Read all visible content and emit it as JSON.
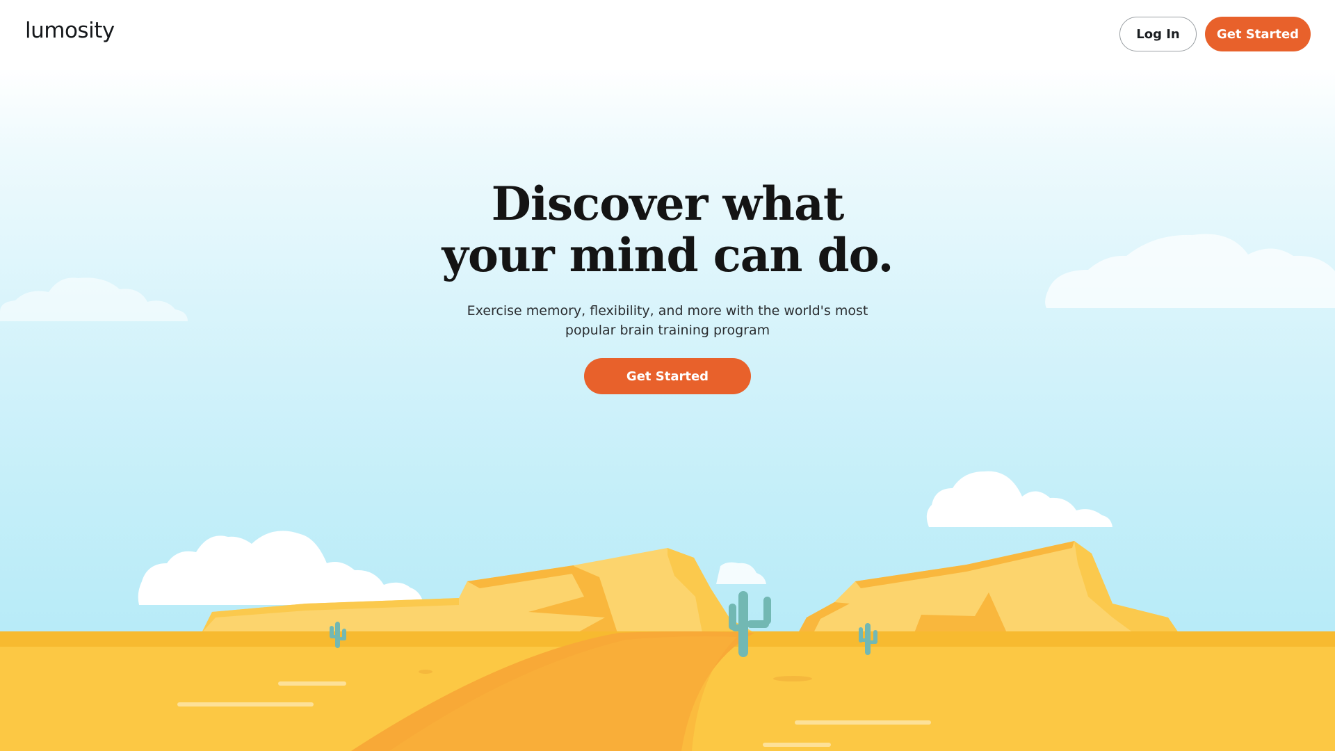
{
  "header": {
    "logo_text": "lumosity",
    "login_label": "Log In",
    "get_started_label": "Get Started"
  },
  "hero": {
    "headline_line1": "Discover what",
    "headline_line2": "your mind can do.",
    "subtext_line1": "Exercise memory, flexibility, and more with the world's most",
    "subtext_line2": "popular brain training program",
    "cta_label": "Get Started"
  },
  "colors": {
    "accent": "#e8612b",
    "sky_top": "#ffffff",
    "sky_bottom": "#b5eaf7",
    "sand": "#fbc23a",
    "mesa": "#fcd46d",
    "cactus": "#72b8b3"
  },
  "icons": [
    "cloud-icon",
    "cactus-icon",
    "mesa-illustration"
  ]
}
